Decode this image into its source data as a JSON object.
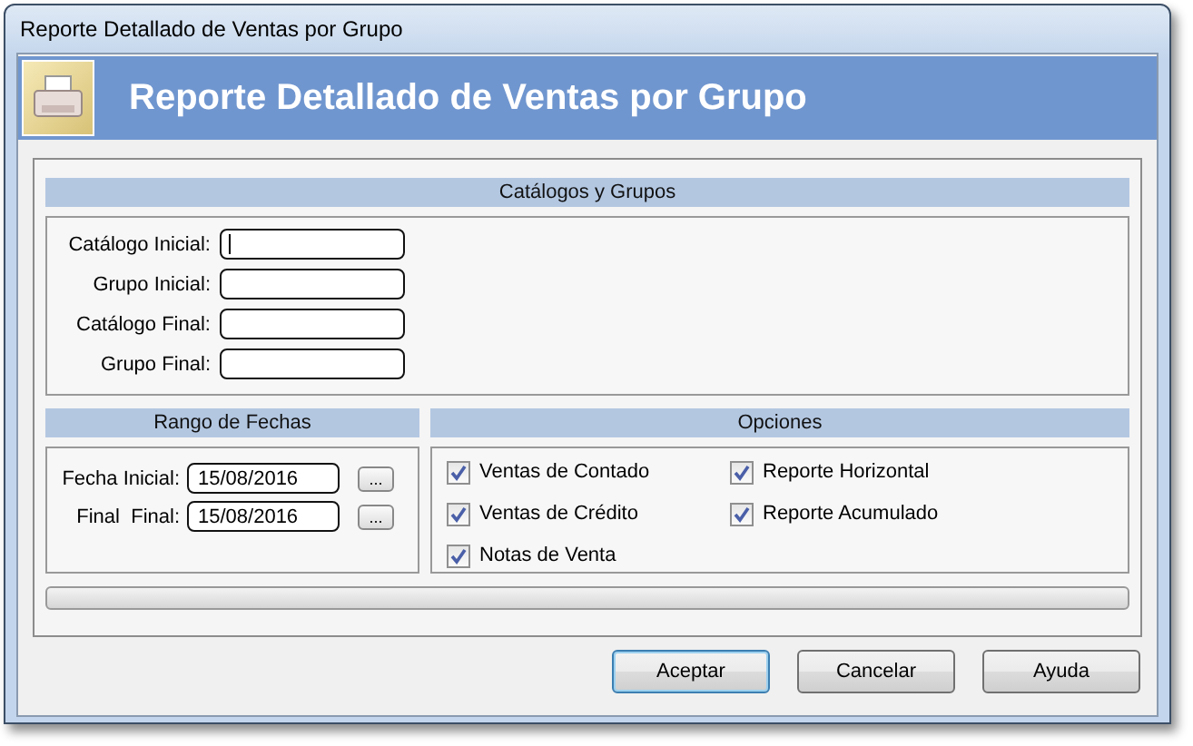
{
  "window": {
    "title": "Reporte Detallado de Ventas por Grupo"
  },
  "banner": {
    "title": "Reporte Detallado de Ventas por Grupo"
  },
  "catalogos": {
    "title": "Catálogos y Grupos",
    "fields": [
      {
        "label": "Catálogo Inicial:",
        "focused": true
      },
      {
        "label": "Grupo Inicial:",
        "focused": false
      },
      {
        "label": "Catálogo Final:",
        "focused": false
      },
      {
        "label": "Grupo Final:",
        "focused": false
      }
    ]
  },
  "fechas": {
    "title": "Rango de Fechas",
    "fields": [
      {
        "label": "Fecha Inicial:",
        "value": "15/08/2016",
        "button": "..."
      },
      {
        "label": "Final  Final:",
        "value": "15/08/2016",
        "button": "..."
      }
    ]
  },
  "opciones": {
    "title": "Opciones",
    "checks": [
      {
        "label": "Ventas de Contado",
        "checked": true
      },
      {
        "label": "Reporte Horizontal",
        "checked": true
      },
      {
        "label": "Ventas de Crédito",
        "checked": true
      },
      {
        "label": "Reporte Acumulado",
        "checked": true
      },
      {
        "label": "Notas de Venta",
        "checked": true
      }
    ]
  },
  "progress": {
    "level": 0
  },
  "buttons": [
    {
      "label": "Aceptar",
      "default": true
    },
    {
      "label": "Cancelar",
      "default": false
    },
    {
      "label": "Ayuda",
      "default": false
    }
  ]
}
